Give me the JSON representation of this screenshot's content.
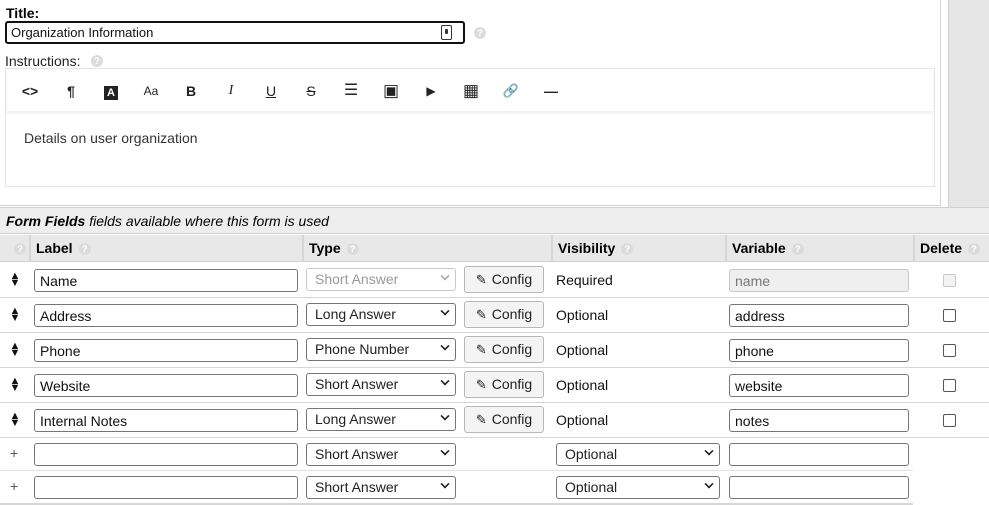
{
  "title_section": {
    "label": "Title:",
    "value": "Organization Information"
  },
  "instructions": {
    "label": "Instructions:",
    "body": "Details on user organization",
    "toolbar": [
      {
        "name": "code-icon",
        "glyph": "<>"
      },
      {
        "name": "paragraph-icon",
        "glyph": "¶"
      },
      {
        "name": "text-color-icon",
        "glyph": "A"
      },
      {
        "name": "font-size-icon",
        "glyph": "Aa"
      },
      {
        "name": "bold-icon",
        "glyph": "B"
      },
      {
        "name": "italic-icon",
        "glyph": "I"
      },
      {
        "name": "underline-icon",
        "glyph": "U"
      },
      {
        "name": "strikethrough-icon",
        "glyph": "S"
      },
      {
        "name": "list-icon",
        "glyph": "☰"
      },
      {
        "name": "image-icon",
        "glyph": "▣"
      },
      {
        "name": "video-icon",
        "glyph": "▶"
      },
      {
        "name": "table-icon",
        "glyph": "▦"
      },
      {
        "name": "link-icon",
        "glyph": "🔗"
      },
      {
        "name": "horizontal-rule-icon",
        "glyph": "—"
      }
    ]
  },
  "form_fields": {
    "header_bold": "Form Fields",
    "header_rest": " fields available where this form is used",
    "columns": {
      "label": "Label",
      "type": "Type",
      "visibility": "Visibility",
      "variable": "Variable",
      "delete": "Delete"
    },
    "config_label": "Config",
    "rows": [
      {
        "label": "Name",
        "type": "Short Answer",
        "visibility": "Required",
        "variable": "name",
        "locked": true
      },
      {
        "label": "Address",
        "type": "Long Answer",
        "visibility": "Optional",
        "variable": "address",
        "locked": false
      },
      {
        "label": "Phone",
        "type": "Phone Number",
        "visibility": "Optional",
        "variable": "phone",
        "locked": false
      },
      {
        "label": "Website",
        "type": "Short Answer",
        "visibility": "Optional",
        "variable": "website",
        "locked": false
      },
      {
        "label": "Internal Notes",
        "type": "Long Answer",
        "visibility": "Optional",
        "variable": "notes",
        "locked": false
      }
    ],
    "new_rows": [
      {
        "marker": "+",
        "label": "",
        "type": "Short Answer",
        "visibility": "Optional",
        "variable": ""
      },
      {
        "marker": "+",
        "label": "",
        "type": "Short Answer",
        "visibility": "Optional",
        "variable": ""
      }
    ]
  }
}
